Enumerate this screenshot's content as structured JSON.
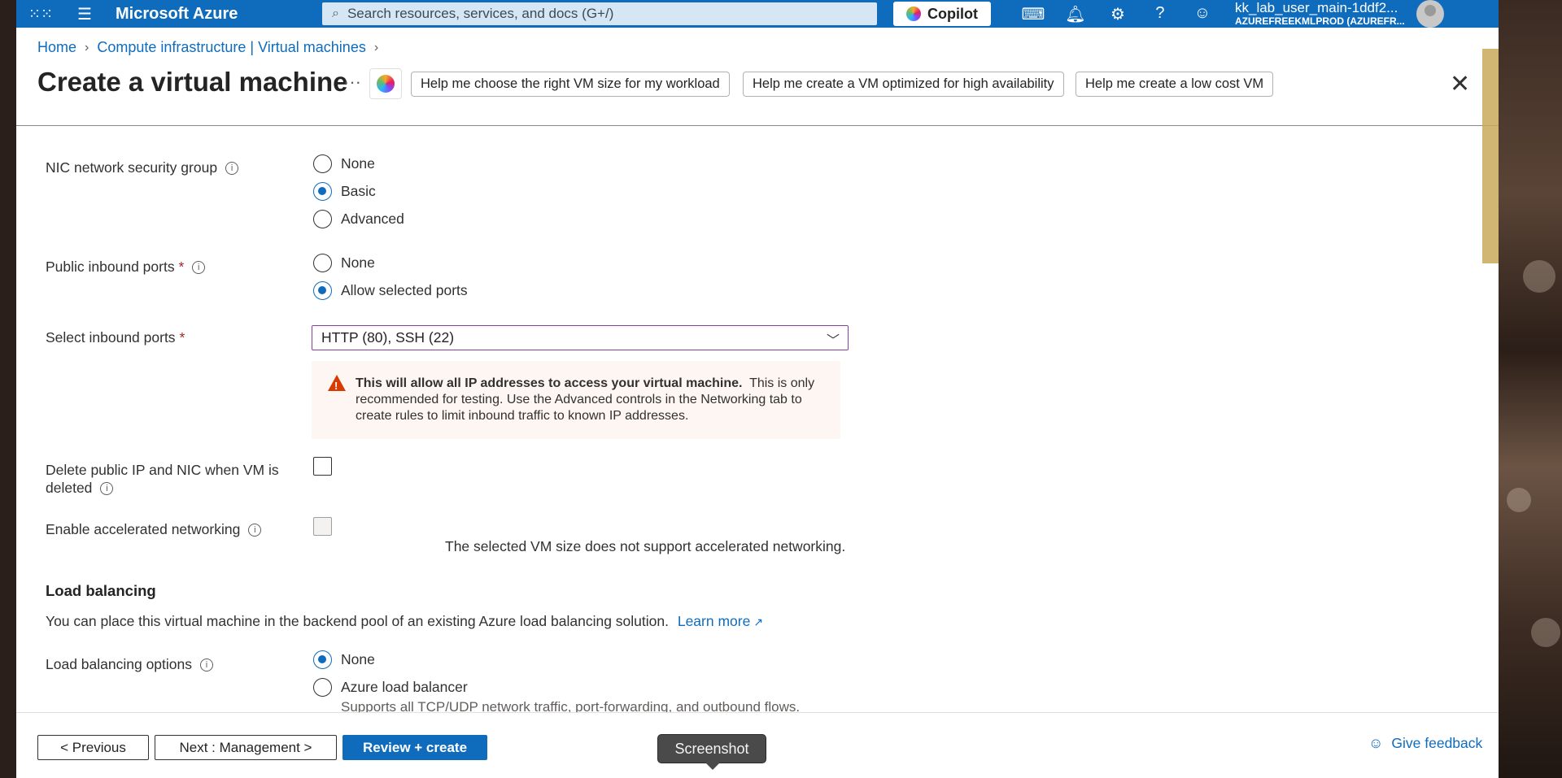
{
  "topbar": {
    "brand": "Microsoft Azure",
    "search_placeholder": "Search resources, services, and docs (G+/)",
    "copilot_label": "Copilot",
    "account_user": "kk_lab_user_main-1ddf2...",
    "account_tenant": "AZUREFREEKMLPROD (AZUREFR..."
  },
  "breadcrumb": {
    "home": "Home",
    "parent": "Compute infrastructure | Virtual machines"
  },
  "header": {
    "title": "Create a virtual machine",
    "more": "···",
    "suggestions": [
      "Help me choose the right VM size for my workload",
      "Help me create a VM optimized for high availability",
      "Help me create a low cost VM"
    ]
  },
  "form": {
    "nic_nsg": {
      "label": "NIC network security group",
      "options": [
        "None",
        "Basic",
        "Advanced"
      ],
      "selected": "Basic"
    },
    "public_inbound_ports": {
      "label": "Public inbound ports",
      "required": "*",
      "options": [
        "None",
        "Allow selected ports"
      ],
      "selected": "Allow selected ports"
    },
    "select_inbound_ports": {
      "label": "Select inbound ports",
      "required": "*",
      "value": "HTTP (80), SSH (22)"
    },
    "warning": {
      "bold": "This will allow all IP addresses to access your virtual machine.",
      "text": "This is only recommended for testing.  Use the Advanced controls in the Networking tab to create rules to limit inbound traffic to known IP addresses."
    },
    "delete_public_ip": {
      "label_line1": "Delete public IP and NIC when VM is",
      "label_line2": "deleted",
      "checked": false
    },
    "accelerated_networking": {
      "label": "Enable accelerated networking",
      "checked": false,
      "note": "The selected VM size does not support accelerated networking."
    },
    "load_balancing": {
      "heading": "Load balancing",
      "description": "You can place this virtual machine in the backend pool of an existing Azure load balancing solution.",
      "learn_more": "Learn more",
      "options_label": "Load balancing options",
      "options": [
        "None",
        "Azure load balancer"
      ],
      "selected": "None",
      "azure_lb_sub": "Supports all TCP/UDP network traffic, port-forwarding, and outbound flows."
    }
  },
  "footer": {
    "previous": "< Previous",
    "next": "Next : Management >",
    "review": "Review + create",
    "feedback": "Give feedback"
  },
  "tooltip": "Screenshot",
  "colors": {
    "azure_blue": "#0f6cbd",
    "warning_bg": "#fdf6f2",
    "warning_icon": "#d83b01",
    "required": "#a4262c",
    "dropdown_focus": "#8a3fa0"
  }
}
